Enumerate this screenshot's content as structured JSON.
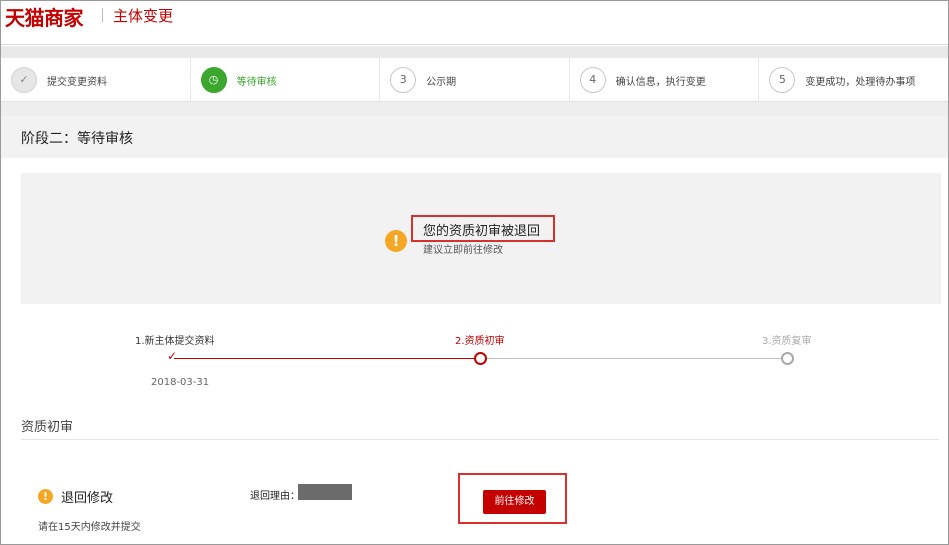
{
  "header": {
    "logo_text": "天猫商家",
    "page_title": "主体变更"
  },
  "steps": [
    {
      "number": "✓",
      "label": "提交变更资料",
      "state": "done"
    },
    {
      "number": "◷",
      "label": "等待审核",
      "state": "active"
    },
    {
      "number": "3",
      "label": "公示期",
      "state": "pending"
    },
    {
      "number": "4",
      "label": "确认信息，执行变更",
      "state": "pending"
    },
    {
      "number": "5",
      "label": "变更成功，处理待办事项",
      "state": "pending"
    }
  ],
  "stage": {
    "title": "阶段二：等待审核"
  },
  "notice": {
    "title": "您的资质初审被退回",
    "subtitle": "建议立即前往修改",
    "icon": "warning-icon"
  },
  "progress": {
    "step1_label": "1.新主体提交资料",
    "step1_date": "2018-03-31",
    "step2_label": "2.资质初审",
    "step3_label": "3.资质复审"
  },
  "section": {
    "title": "资质初审"
  },
  "returned": {
    "title": "退回修改",
    "hint": "请在15天内修改并提交",
    "reason_label": "退回理由：",
    "button_label": "前往修改"
  },
  "colors": {
    "brand_red": "#c40000",
    "active_green": "#3ba72e",
    "warning_orange": "#f5a623",
    "highlight_red": "#d8312b"
  }
}
